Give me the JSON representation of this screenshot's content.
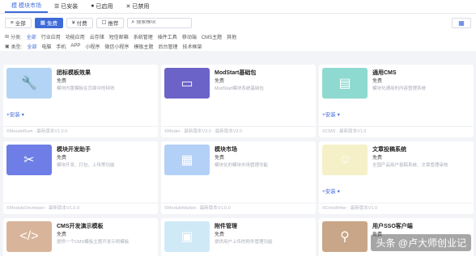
{
  "tabs": [
    {
      "label": "模块市场",
      "icon": "模",
      "active": true
    },
    {
      "label": "已安装",
      "icon": "☰",
      "active": false
    },
    {
      "label": "已启用",
      "icon": "●",
      "active": false
    },
    {
      "label": "已禁用",
      "icon": "✕",
      "active": false
    }
  ],
  "toolbar": {
    "all": "全部",
    "free": "免费",
    "paid": "付费",
    "recommend": "推荐",
    "search_placeholder": "搜索模块"
  },
  "filters": {
    "category_label": "分类:",
    "category_options": [
      "全部",
      "行业应用",
      "功能应用",
      "云存储",
      "短信邮箱",
      "系统管理",
      "插件工具",
      "移动端",
      "CMS主题",
      "其他"
    ],
    "type_label": "类型:",
    "type_options": [
      "全部",
      "电脑",
      "手机",
      "APP",
      "小程序",
      "微信小程序",
      "模板主题",
      "后台管理",
      "技术框架"
    ]
  },
  "cards": [
    {
      "title": "团标模板效果",
      "price": "免费",
      "desc": "模块内置模板在页面中的特效",
      "install": "+安装 ▾",
      "meta": "©MoudoRum · 最新版本V1.0.0",
      "color": "#b3d4f5",
      "icon": "🔧"
    },
    {
      "title": "ModStart基础包",
      "price": "免费",
      "desc": "ModStart模块系统基础包",
      "install": "",
      "meta": "©Moder · 最新版本V3.0 · 最新版本V3.0",
      "color": "#6c63c9",
      "icon": "▭"
    },
    {
      "title": "通用CMS",
      "price": "免费",
      "desc": "模块化通用的内容管理系统",
      "install": "+安装 ▾",
      "meta": "©CMS · 最新版本V1.0",
      "color": "#8ed9d0",
      "icon": "▤"
    },
    {
      "title": "模块开发助手",
      "price": "免费",
      "desc": "模块开发、打包、上传等功能",
      "install": "",
      "meta": "©ModuleDeveloper · 最新版本V1.0.0",
      "color": "#6e7ee6",
      "icon": "✂"
    },
    {
      "title": "模块市场",
      "price": "免费",
      "desc": "模块化的模块市场管理功能",
      "install": "",
      "meta": "©ModuleMarket · 最新版本V1.0.0",
      "color": "#b3d0f7",
      "icon": "▦"
    },
    {
      "title": "文章投稿系统",
      "price": "免费",
      "desc": "全国产品用户投稿系统、文章管理审核",
      "install": "+安装 ▾",
      "meta": "©CmsWriter · 最新版本V1.0",
      "color": "#f5f0c7",
      "icon": "☺"
    },
    {
      "title": "CMS开发演示模板",
      "price": "免费",
      "desc": "提供一个CMS模板主题开发示例模板",
      "install": "",
      "meta": "",
      "color": "#d8b59a",
      "icon": "</>"
    },
    {
      "title": "附件管理",
      "price": "免费",
      "desc": "提供用户上传的附件管理功能",
      "install": "",
      "meta": "",
      "color": "#cfe9f7",
      "icon": "▣"
    },
    {
      "title": "用户SSO客户端",
      "price": "免费",
      "desc": "",
      "install": "",
      "meta": "",
      "color": "#c9a688",
      "icon": "⚲"
    }
  ],
  "watermark": "头条 @卢大师创业记"
}
